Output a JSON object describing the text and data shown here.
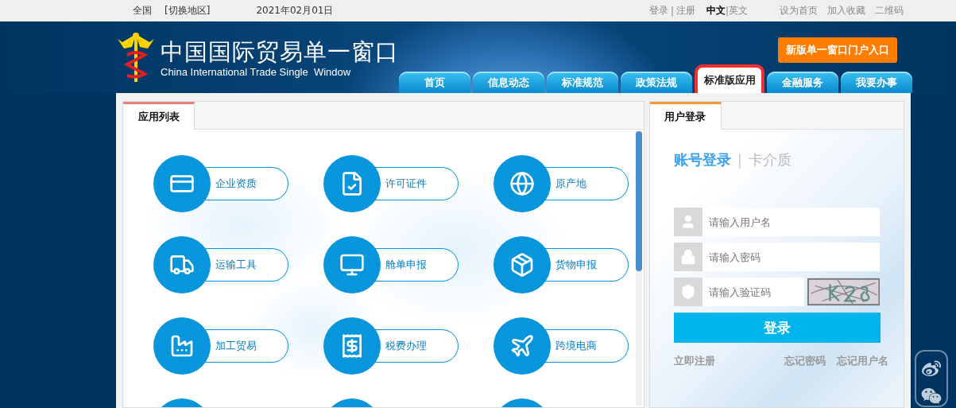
{
  "top_bar": {
    "region": "全国",
    "switch_region": "[切换地区]",
    "date": "2021年02月01日",
    "account_links": [
      "登录",
      "注册"
    ],
    "separator": "|",
    "languages": [
      {
        "label": "中文",
        "selected": true
      },
      {
        "label": "英文",
        "selected": false
      }
    ],
    "links": [
      "设为首页",
      "加入收藏",
      "二维码"
    ]
  },
  "header": {
    "title": "中国国际贸易单一窗口",
    "subtitle": "China International Trade Single  Window",
    "portal_button": "新版单一窗口门户入口",
    "nav_tabs": [
      {
        "label": "首页",
        "selected": false
      },
      {
        "label": "信息动态",
        "selected": false
      },
      {
        "label": "标准规范",
        "selected": false
      },
      {
        "label": "政策法规",
        "selected": false
      },
      {
        "label": "标准版应用",
        "selected": true
      },
      {
        "label": "金融服务",
        "selected": false
      },
      {
        "label": "我要办事",
        "selected": false
      }
    ]
  },
  "app_panel": {
    "tab": "应用列表",
    "apps": [
      {
        "label": "企业资质"
      },
      {
        "label": "许可证件"
      },
      {
        "label": "原产地"
      },
      {
        "label": "运输工具"
      },
      {
        "label": "舱单申报"
      },
      {
        "label": "货物申报"
      },
      {
        "label": "加工贸易"
      },
      {
        "label": "税费办理"
      },
      {
        "label": "跨境电商"
      }
    ]
  },
  "login_panel": {
    "tab": "用户登录",
    "modes": [
      {
        "label": "账号登录",
        "selected": true
      },
      {
        "label": "卡介质",
        "selected": false
      }
    ],
    "separator": "|",
    "fields": [
      {
        "kind": "user",
        "placeholder": "请输入用户名"
      },
      {
        "kind": "password",
        "placeholder": "请输入密码"
      },
      {
        "kind": "captcha",
        "placeholder": "请输入验证码"
      }
    ],
    "submit": "登录",
    "register": "立即注册",
    "forgot_links": [
      "忘记密码",
      "忘记用户名"
    ]
  }
}
